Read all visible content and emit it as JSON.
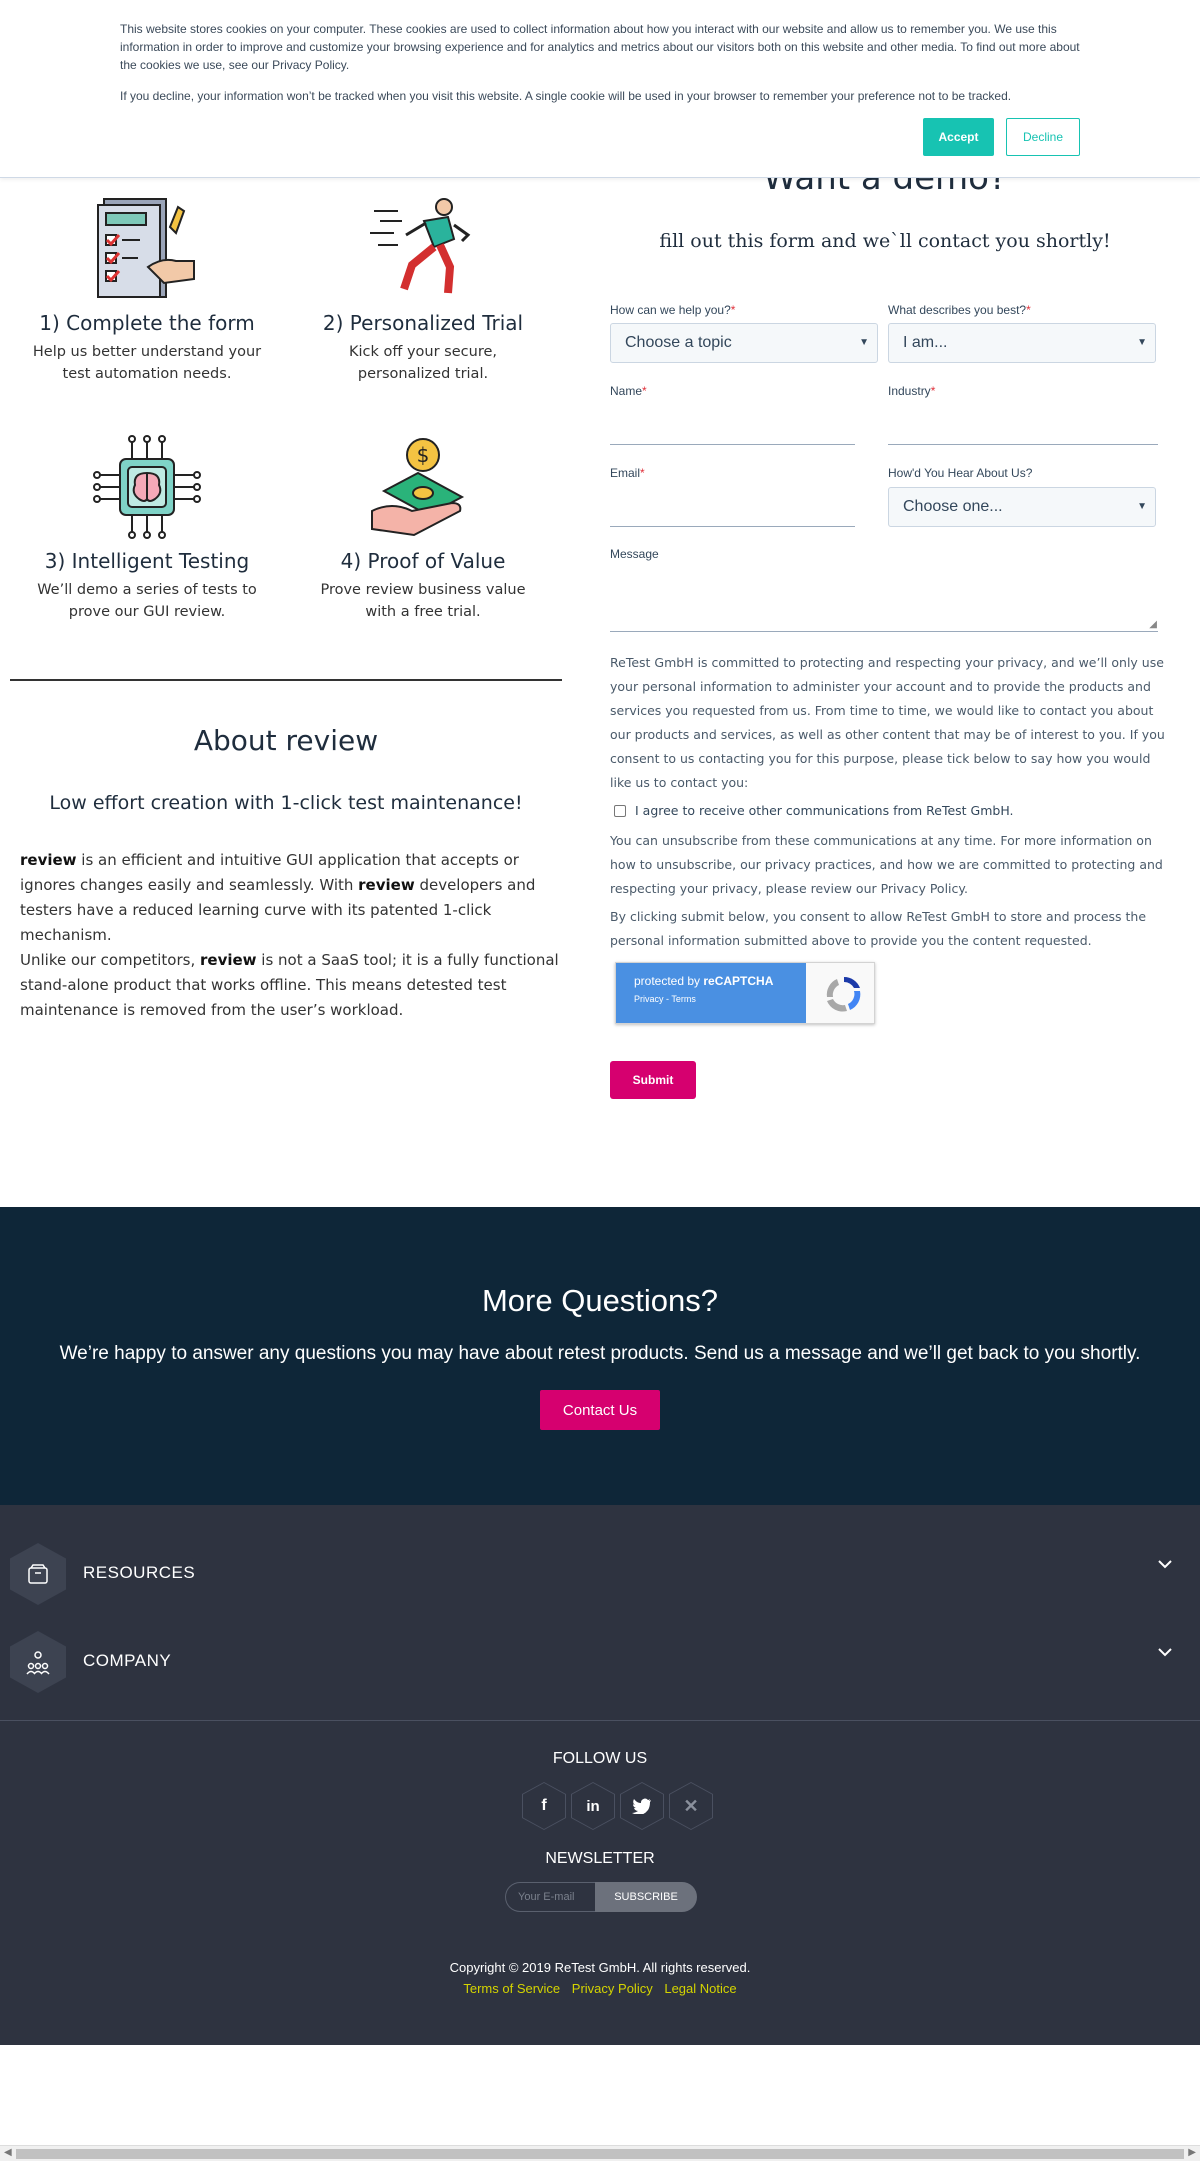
{
  "cookie": {
    "text1": "This website stores cookies on your computer. These cookies are used to collect information about how you interact with our website and allow us to remember you. We use this information in order to improve and customize your browsing experience and for analytics and metrics about our visitors both on this website and other media. To find out more about the cookies we use, see our Privacy Policy.",
    "text2": "If you decline, your information won’t be tracked when you visit this website. A single cookie will be used in your browser to remember your preference not to be tracked.",
    "accept": "Accept",
    "decline": "Decline"
  },
  "steps": [
    {
      "title": "1) Complete the form",
      "desc": "Help us better understand your test automation needs.",
      "icon": "checklist-icon"
    },
    {
      "title": "2) Personalized Trial",
      "desc": "Kick off your secure, personalized trial.",
      "icon": "runner-icon"
    },
    {
      "title": "3) Intelligent Testing",
      "desc": "We’ll demo a series of tests to prove our GUI review.",
      "icon": "brain-chip-icon"
    },
    {
      "title": "4) Proof of Value",
      "desc": "Prove review business value with a free trial.",
      "icon": "money-hand-icon"
    }
  ],
  "about": {
    "title": "About review",
    "subtitle": "Low effort creation with 1-click test maintenance!",
    "p1_b1": "review",
    "p1_t1": " is an efficient and intuitive GUI application that accepts or ignores changes easily and seamlessly. With ",
    "p1_b2": "review",
    "p1_t2": " developers and testers have a reduced learning curve with its patented 1-click mechanism.",
    "p2_t1": "Unlike our competitors, ",
    "p2_b1": "review",
    "p2_t2": " is not a SaaS tool; it is a fully functional stand-alone product that works offline. This means detested test maintenance is removed from the user’s workload."
  },
  "form": {
    "title": "Want a demo?",
    "subtitle": "fill out this form and we`ll contact you shortly!",
    "help_label": "How can we help you?",
    "help_value": "Choose a topic",
    "describe_label": "What describes you best?",
    "describe_value": "I am...",
    "name_label": "Name",
    "industry_label": "Industry",
    "email_label": "Email",
    "hear_label": "How'd You Hear About Us?",
    "hear_value": "Choose one...",
    "message_label": "Message",
    "required_mark": "*",
    "privacy1": "ReTest GmbH is committed to protecting and respecting your privacy, and we’ll only use your personal information to administer your account and to provide the products and services you requested from us. From time to time, we would like to contact you about our products and services, as well as other content that may be of interest to you. If you consent to us contacting you for this purpose, please tick below to say how you would like us to contact you:",
    "checkbox_label": "I agree to receive other communications from ReTest GmbH.",
    "privacy2": "You can unsubscribe from these communications at any time. For more information on how to unsubscribe, our privacy practices, and how we are committed to protecting and respecting your privacy, please review our Privacy Policy.",
    "privacy3": "By clicking submit below, you consent to allow ReTest GmbH to store and process the personal information submitted above to provide you the content requested.",
    "captcha_prefix": "protected by ",
    "captcha_brand": "reCAPTCHA",
    "captcha_links": "Privacy - Terms",
    "submit": "Submit"
  },
  "more_questions": {
    "title": "More Questions?",
    "text": "We’re happy to answer any questions you may have about retest products. Send us a message and we’ll get back to you shortly.",
    "button": "Contact Us"
  },
  "footer": {
    "resources": "RESOURCES",
    "company": "COMPANY",
    "follow": "FOLLOW US",
    "newsletter": "NEWSLETTER",
    "email_placeholder": "Your E-mail",
    "subscribe": "SUBSCRIBE",
    "copyright": "Copyright © 2019 ReTest GmbH. All rights reserved.",
    "links": [
      "Terms of Service",
      "Privacy Policy",
      "Legal Notice"
    ]
  },
  "colors": {
    "accent_teal": "#17c3b2",
    "accent_pink": "#d6006f",
    "dark_navy": "#0e2638",
    "footer_bg": "#2e3340"
  }
}
